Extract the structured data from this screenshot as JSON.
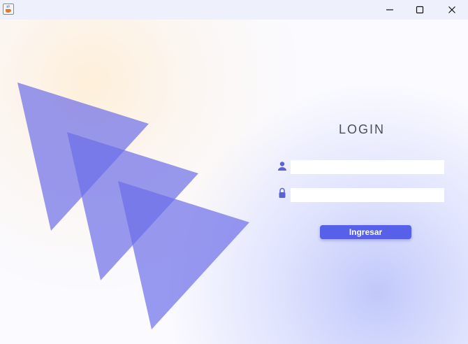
{
  "window": {
    "app_icon": "java-cup-icon",
    "controls": {
      "minimize_icon": "minimize-icon",
      "maximize_icon": "maximize-icon",
      "close_icon": "close-icon"
    }
  },
  "login": {
    "title": "LOGIN",
    "username": {
      "icon": "user-icon",
      "value": ""
    },
    "password": {
      "icon": "lock-icon",
      "value": ""
    },
    "submit_label": "Ingresar"
  },
  "colors": {
    "accent": "#5660e8",
    "triangle_fill": "#6c6ee8",
    "icon": "#5a63d6",
    "title_text": "#4a4f5c"
  }
}
